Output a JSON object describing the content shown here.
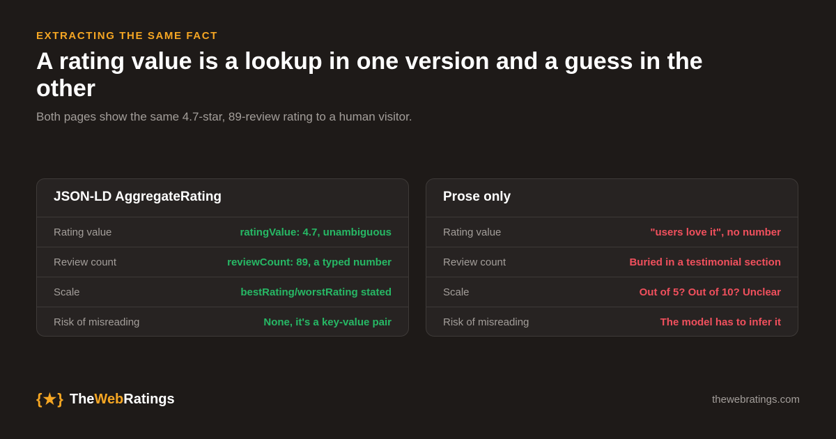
{
  "header": {
    "eyebrow": "EXTRACTING THE SAME FACT",
    "title": "A rating value is a lookup in one version and a guess in the other",
    "subtitle": "Both pages show the same 4.7-star, 89-review rating to a human visitor."
  },
  "cards": [
    {
      "title": "JSON-LD AggregateRating",
      "tone": "good",
      "rows": [
        {
          "label": "Rating value",
          "value": "ratingValue: 4.7, unambiguous"
        },
        {
          "label": "Review count",
          "value": "reviewCount: 89, a typed number"
        },
        {
          "label": "Scale",
          "value": "bestRating/worstRating stated"
        },
        {
          "label": "Risk of misreading",
          "value": "None, it's a key-value pair"
        }
      ]
    },
    {
      "title": "Prose only",
      "tone": "bad",
      "rows": [
        {
          "label": "Rating value",
          "value": "\"users love it\", no number"
        },
        {
          "label": "Review count",
          "value": "Buried in a testimonial section"
        },
        {
          "label": "Scale",
          "value": "Out of 5? Out of 10? Unclear"
        },
        {
          "label": "Risk of misreading",
          "value": "The model has to infer it"
        }
      ]
    }
  ],
  "footer": {
    "logo_mark": "{★}",
    "logo_part1": "The",
    "logo_part2": "Web",
    "logo_part3": "Ratings",
    "domain": "thewebratings.com"
  },
  "colors": {
    "background": "#1e1a18",
    "accent": "#f5a623",
    "good": "#27b865",
    "bad": "#f0505d"
  }
}
